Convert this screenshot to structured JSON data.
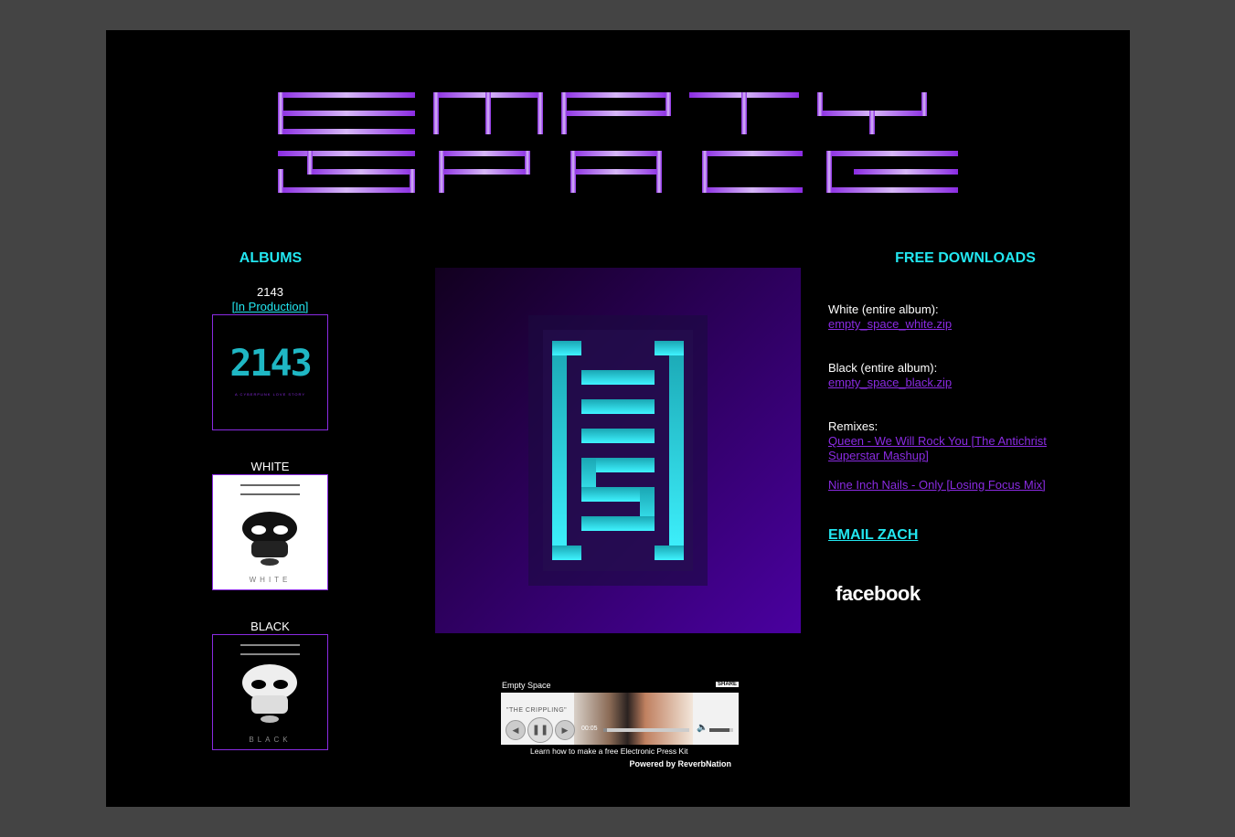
{
  "logo": {
    "lines": [
      "EMPTY",
      "SPACE"
    ],
    "colors": [
      "#8a2be2",
      "#cda9f5"
    ]
  },
  "albums": {
    "title": "ALBUMS",
    "items": [
      {
        "name": "2143",
        "status": "[In Production]",
        "cover_text": "2143",
        "cover_caption": "A CYBERPUNK LOVE STORY"
      },
      {
        "name": "WHITE",
        "cover_text": "WHITE"
      },
      {
        "name": "BLACK",
        "cover_text": "BLACK"
      }
    ]
  },
  "downloads": {
    "title": "FREE DOWNLOADS",
    "white_label": "White (entire album):",
    "white_link": "empty_space_white.zip",
    "black_label": "Black (entire album):",
    "black_link": "empty_space_black.zip",
    "remixes_label": "Remixes:",
    "remix_1": "Queen - We Will Rock You [The Antichrist Superstar Mashup]",
    "remix_2": "Nine Inch Nails - Only [Losing Focus Mix]"
  },
  "email": "EMAIL ZACH",
  "facebook": "facebook",
  "player": {
    "title": "Empty Space",
    "share": "SHARE",
    "track": "\"THE CRIPPLING\"",
    "time": "00:05",
    "progress": 0.04,
    "volume": 0.85,
    "tagline": "Learn how to make a free Electronic Press Kit",
    "powered": "Powered by ReverbNation"
  },
  "colors": {
    "accent_cyan": "#22e6f0",
    "accent_purple": "#8a2be2",
    "page_bg": "#000000",
    "outer_bg": "#444444"
  }
}
